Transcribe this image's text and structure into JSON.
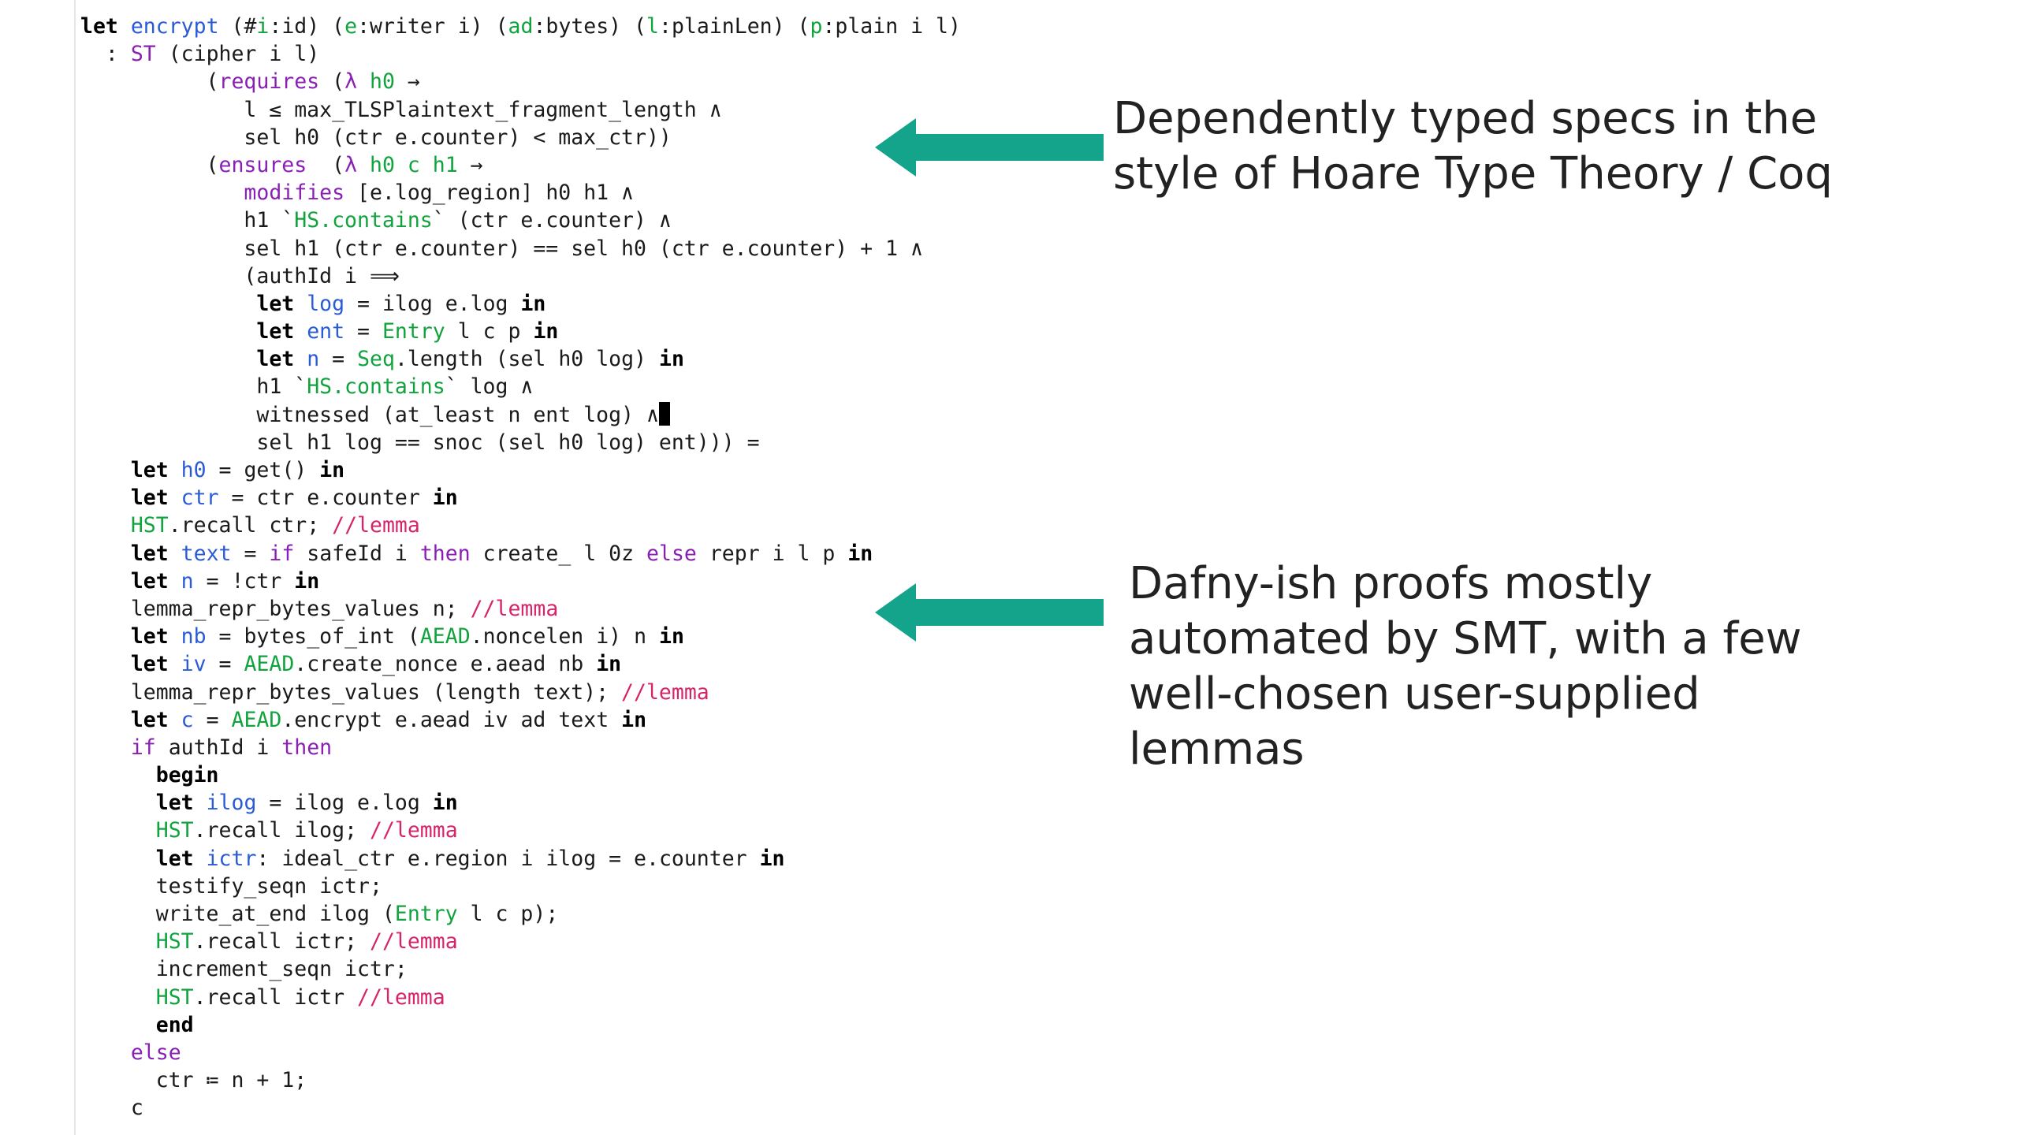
{
  "colors": {
    "keyword": "#000000",
    "identifier": "#2a5bd7",
    "type_keyword": "#8a1fb5",
    "module": "#11a33d",
    "comment": "#d6246a",
    "arrow": "#14a38b"
  },
  "icons": {
    "arrow": "left-arrow-icon"
  },
  "code": [
    [
      [
        "kw",
        "let"
      ],
      [
        "t",
        " "
      ],
      [
        "id",
        "encrypt"
      ],
      [
        "t",
        " (#"
      ],
      [
        "mod",
        "i"
      ],
      [
        "t",
        ":id) ("
      ],
      [
        "mod",
        "e"
      ],
      [
        "t",
        ":writer i) ("
      ],
      [
        "mod",
        "ad"
      ],
      [
        "t",
        ":bytes) ("
      ],
      [
        "mod",
        "l"
      ],
      [
        "t",
        ":plainLen) ("
      ],
      [
        "mod",
        "p"
      ],
      [
        "t",
        ":plain i l)"
      ]
    ],
    [
      [
        "t",
        "  : "
      ],
      [
        "ty",
        "ST"
      ],
      [
        "t",
        " (cipher i l)"
      ]
    ],
    [
      [
        "t",
        "          ("
      ],
      [
        "ty",
        "requires"
      ],
      [
        "t",
        " ("
      ],
      [
        "ty",
        "λ"
      ],
      [
        "t",
        " "
      ],
      [
        "mod",
        "h0"
      ],
      [
        "t",
        " →"
      ]
    ],
    [
      [
        "t",
        "             l ≤ max_TLSPlaintext_fragment_length ∧"
      ]
    ],
    [
      [
        "t",
        "             sel h0 (ctr e.counter) < max_ctr))"
      ]
    ],
    [
      [
        "t",
        "          ("
      ],
      [
        "ty",
        "ensures"
      ],
      [
        "t",
        "  ("
      ],
      [
        "ty",
        "λ"
      ],
      [
        "t",
        " "
      ],
      [
        "mod",
        "h0 c h1"
      ],
      [
        "t",
        " →"
      ]
    ],
    [
      [
        "t",
        "             "
      ],
      [
        "ty",
        "modifies"
      ],
      [
        "t",
        " [e.log_region] h0 h1 ∧"
      ]
    ],
    [
      [
        "t",
        "             h1 `"
      ],
      [
        "mod",
        "HS.contains"
      ],
      [
        "t",
        "` (ctr e.counter) ∧"
      ]
    ],
    [
      [
        "t",
        "             sel h1 (ctr e.counter) == sel h0 (ctr e.counter) + 1 ∧"
      ]
    ],
    [
      [
        "t",
        "             (authId i ⟹"
      ]
    ],
    [
      [
        "t",
        "              "
      ],
      [
        "kw",
        "let"
      ],
      [
        "t",
        " "
      ],
      [
        "id",
        "log"
      ],
      [
        "t",
        " = ilog e.log "
      ],
      [
        "kw",
        "in"
      ]
    ],
    [
      [
        "t",
        "              "
      ],
      [
        "kw",
        "let"
      ],
      [
        "t",
        " "
      ],
      [
        "id",
        "ent"
      ],
      [
        "t",
        " = "
      ],
      [
        "mod",
        "Entry"
      ],
      [
        "t",
        " l c p "
      ],
      [
        "kw",
        "in"
      ]
    ],
    [
      [
        "t",
        "              "
      ],
      [
        "kw",
        "let"
      ],
      [
        "t",
        " "
      ],
      [
        "id",
        "n"
      ],
      [
        "t",
        " = "
      ],
      [
        "mod",
        "Seq"
      ],
      [
        "t",
        ".length (sel h0 log) "
      ],
      [
        "kw",
        "in"
      ]
    ],
    [
      [
        "t",
        "              h1 `"
      ],
      [
        "mod",
        "HS.contains"
      ],
      [
        "t",
        "` log ∧"
      ]
    ],
    [
      [
        "t",
        "              witnessed (at_least n ent log) ∧"
      ],
      [
        "cursor",
        ""
      ]
    ],
    [
      [
        "t",
        "              sel h1 log == snoc (sel h0 log) ent))) ="
      ]
    ],
    [
      [
        "t",
        "    "
      ],
      [
        "kw",
        "let"
      ],
      [
        "t",
        " "
      ],
      [
        "id",
        "h0"
      ],
      [
        "t",
        " = get() "
      ],
      [
        "kw",
        "in"
      ]
    ],
    [
      [
        "t",
        "    "
      ],
      [
        "kw",
        "let"
      ],
      [
        "t",
        " "
      ],
      [
        "id",
        "ctr"
      ],
      [
        "t",
        " = ctr e.counter "
      ],
      [
        "kw",
        "in"
      ]
    ],
    [
      [
        "t",
        "    "
      ],
      [
        "mod",
        "HST"
      ],
      [
        "t",
        ".recall ctr; "
      ],
      [
        "cm",
        "//lemma"
      ]
    ],
    [
      [
        "t",
        "    "
      ],
      [
        "kw",
        "let"
      ],
      [
        "t",
        " "
      ],
      [
        "id",
        "text"
      ],
      [
        "t",
        " = "
      ],
      [
        "kw2",
        "if"
      ],
      [
        "t",
        " safeId i "
      ],
      [
        "kw2",
        "then"
      ],
      [
        "t",
        " create_ l 0z "
      ],
      [
        "kw2",
        "else"
      ],
      [
        "t",
        " repr i l p "
      ],
      [
        "kw",
        "in"
      ]
    ],
    [
      [
        "t",
        "    "
      ],
      [
        "kw",
        "let"
      ],
      [
        "t",
        " "
      ],
      [
        "id",
        "n"
      ],
      [
        "t",
        " = !ctr "
      ],
      [
        "kw",
        "in"
      ]
    ],
    [
      [
        "t",
        "    lemma_repr_bytes_values n; "
      ],
      [
        "cm",
        "//lemma"
      ]
    ],
    [
      [
        "t",
        "    "
      ],
      [
        "kw",
        "let"
      ],
      [
        "t",
        " "
      ],
      [
        "id",
        "nb"
      ],
      [
        "t",
        " = bytes_of_int ("
      ],
      [
        "mod",
        "AEAD"
      ],
      [
        "t",
        ".noncelen i) n "
      ],
      [
        "kw",
        "in"
      ]
    ],
    [
      [
        "t",
        "    "
      ],
      [
        "kw",
        "let"
      ],
      [
        "t",
        " "
      ],
      [
        "id",
        "iv"
      ],
      [
        "t",
        " = "
      ],
      [
        "mod",
        "AEAD"
      ],
      [
        "t",
        ".create_nonce e.aead nb "
      ],
      [
        "kw",
        "in"
      ]
    ],
    [
      [
        "t",
        "    lemma_repr_bytes_values (length text); "
      ],
      [
        "cm",
        "//lemma"
      ]
    ],
    [
      [
        "t",
        "    "
      ],
      [
        "kw",
        "let"
      ],
      [
        "t",
        " "
      ],
      [
        "id",
        "c"
      ],
      [
        "t",
        " = "
      ],
      [
        "mod",
        "AEAD"
      ],
      [
        "t",
        ".encrypt e.aead iv ad text "
      ],
      [
        "kw",
        "in"
      ]
    ],
    [
      [
        "t",
        "    "
      ],
      [
        "kw2",
        "if"
      ],
      [
        "t",
        " authId i "
      ],
      [
        "kw2",
        "then"
      ]
    ],
    [
      [
        "t",
        "      "
      ],
      [
        "kw",
        "begin"
      ]
    ],
    [
      [
        "t",
        "      "
      ],
      [
        "kw",
        "let"
      ],
      [
        "t",
        " "
      ],
      [
        "id",
        "ilog"
      ],
      [
        "t",
        " = ilog e.log "
      ],
      [
        "kw",
        "in"
      ]
    ],
    [
      [
        "t",
        "      "
      ],
      [
        "mod",
        "HST"
      ],
      [
        "t",
        ".recall ilog; "
      ],
      [
        "cm",
        "//lemma"
      ]
    ],
    [
      [
        "t",
        "      "
      ],
      [
        "kw",
        "let"
      ],
      [
        "t",
        " "
      ],
      [
        "id",
        "ictr"
      ],
      [
        "t",
        ": ideal_ctr e.region i ilog = e.counter "
      ],
      [
        "kw",
        "in"
      ]
    ],
    [
      [
        "t",
        "      testify_seqn ictr;"
      ]
    ],
    [
      [
        "t",
        "      write_at_end ilog ("
      ],
      [
        "mod",
        "Entry"
      ],
      [
        "t",
        " l c p);"
      ]
    ],
    [
      [
        "t",
        "      "
      ],
      [
        "mod",
        "HST"
      ],
      [
        "t",
        ".recall ictr; "
      ],
      [
        "cm",
        "//lemma"
      ]
    ],
    [
      [
        "t",
        "      increment_seqn ictr;"
      ]
    ],
    [
      [
        "t",
        "      "
      ],
      [
        "mod",
        "HST"
      ],
      [
        "t",
        ".recall ictr "
      ],
      [
        "cm",
        "//lemma"
      ]
    ],
    [
      [
        "t",
        "      "
      ],
      [
        "kw",
        "end"
      ]
    ],
    [
      [
        "t",
        "    "
      ],
      [
        "kw2",
        "else"
      ]
    ],
    [
      [
        "t",
        "      ctr ≔ n + 1;"
      ]
    ],
    [
      [
        "t",
        "    c"
      ]
    ]
  ],
  "callouts": {
    "specs": [
      "Dependently typed specs in the",
      "style of Hoare Type Theory / Coq"
    ],
    "proofs": [
      "Dafny-ish proofs mostly",
      "automated by SMT, with a few",
      "well-chosen user-supplied",
      "lemmas"
    ]
  }
}
